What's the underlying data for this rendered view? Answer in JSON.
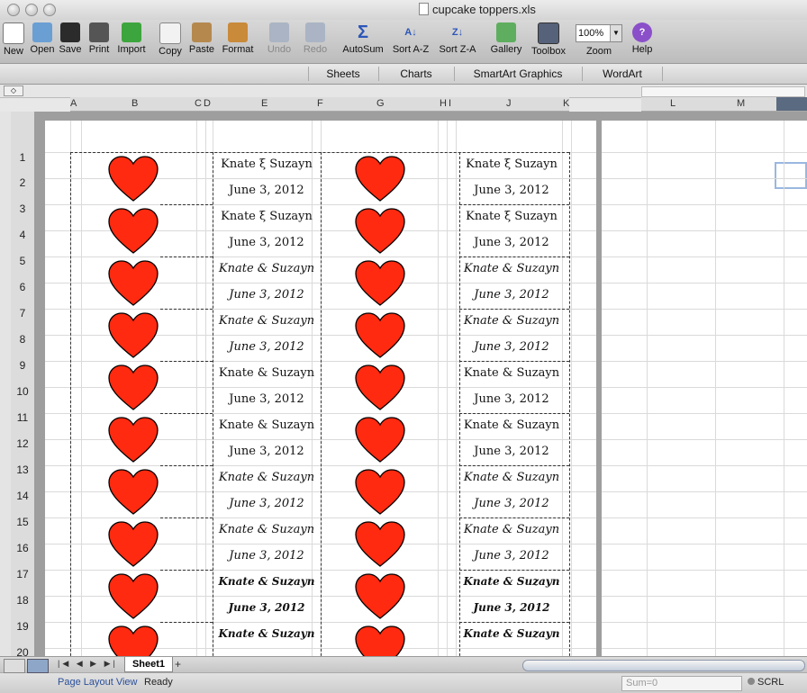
{
  "window": {
    "title": "cupcake toppers.xls"
  },
  "toolbar": {
    "items": [
      "New",
      "Open",
      "Save",
      "Print",
      "Import",
      "Copy",
      "Paste",
      "Format",
      "Undo",
      "Redo",
      "AutoSum",
      "Sort A-Z",
      "Sort Z-A",
      "Gallery",
      "Toolbox",
      "Zoom",
      "Help"
    ],
    "zoom_value": "100%"
  },
  "ribbon": {
    "tabs": [
      "Sheets",
      "Charts",
      "SmartArt Graphics",
      "WordArt"
    ]
  },
  "columns": {
    "left": [
      "A",
      "B",
      "C",
      "D",
      "E",
      "F",
      "G",
      "H",
      "I",
      "J",
      "K"
    ],
    "right": [
      "L",
      "M"
    ]
  },
  "rows": [
    "1",
    "2",
    "3",
    "4",
    "5",
    "6",
    "7",
    "8",
    "9",
    "10",
    "11",
    "12",
    "13",
    "14",
    "15",
    "16",
    "17",
    "18",
    "19",
    "20"
  ],
  "labels": {
    "names": [
      "Knate ξ Suzayn",
      "Knate ξ Suzayn",
      "Knate & Suzayn",
      "Knate & Suzayn",
      "Knate & Suzayn",
      "Knate & Suzayn",
      "Knate & Suzayn",
      "Knate & Suzayn",
      "Knate & Suzayn",
      "Knate & Suzayn"
    ],
    "dates": [
      "June 3, 2012",
      "June 3, 2012",
      "June 3, 2012",
      "June 3, 2012",
      "June 3, 2012",
      "June 3, 2012",
      "June 3, 2012",
      "June 3, 2012",
      "June 3, 2012"
    ]
  },
  "sheets": {
    "tab": "Sheet1",
    "add": "+"
  },
  "status": {
    "view": "Page Layout View",
    "ready": "Ready",
    "sum": "Sum=0",
    "scrl": "SCRL"
  },
  "colors": {
    "heart": "#ff2a0f",
    "toolbar": "#c8c8c8"
  }
}
